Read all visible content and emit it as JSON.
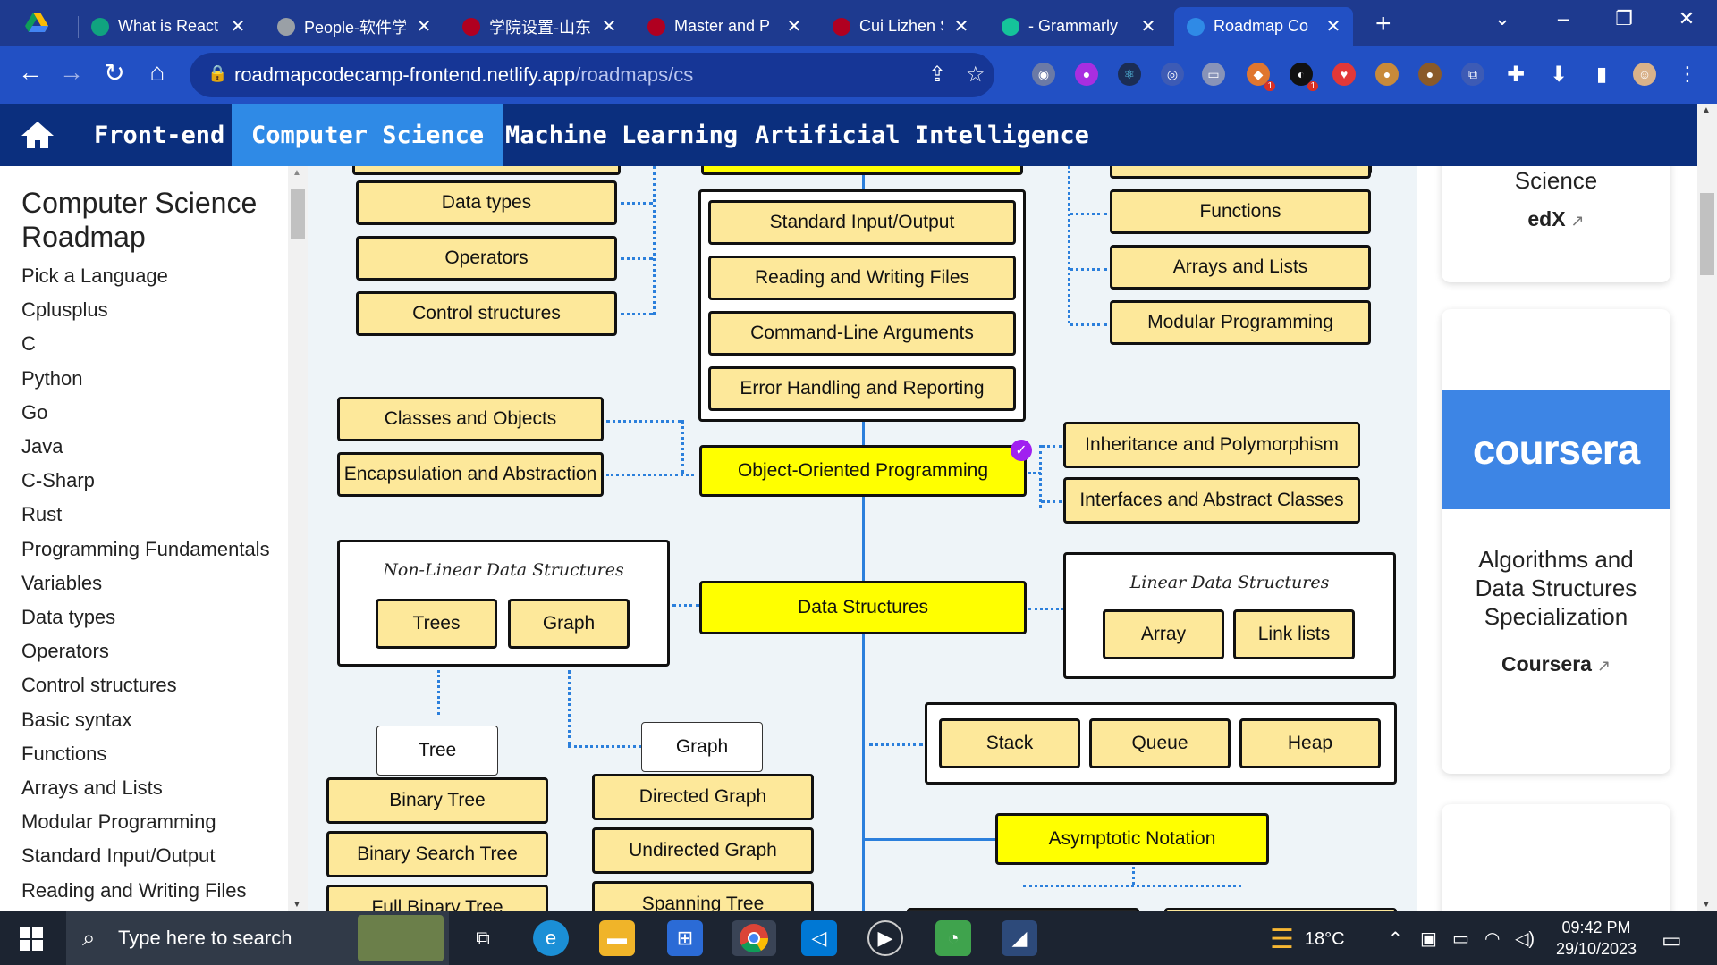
{
  "browser": {
    "tabs": [
      {
        "title": "What is React",
        "color": "#10a37f",
        "glyph": "chatgpt-icon"
      },
      {
        "title": "People-软件学",
        "color": "#9aa0a6",
        "glyph": "globe-icon"
      },
      {
        "title": "学院设置-山东",
        "color": "#b00020",
        "glyph": "university-icon"
      },
      {
        "title": "Master and P",
        "color": "#b00020",
        "glyph": "university-icon"
      },
      {
        "title": "Cui Lizhen Sh",
        "color": "#b00020",
        "glyph": "university-icon"
      },
      {
        "title": "- Grammarly",
        "color": "#15c39a",
        "glyph": "G"
      },
      {
        "title": "Roadmap Co",
        "color": "#2f8ae6",
        "glyph": "RC"
      }
    ],
    "url_host": "roadmapcodecamp-frontend.netlify.app",
    "url_path": "/roadmaps/cs",
    "ext_badges": [
      "1",
      "1"
    ]
  },
  "nav": {
    "items": [
      "Front-end",
      "Computer Science",
      "Machine Learning",
      "Artificial Intelligence"
    ],
    "active": "Computer Science"
  },
  "sidebar": {
    "title": "Computer Science Roadmap",
    "items": [
      "Pick a Language",
      "Cplusplus",
      "C",
      "Python",
      "Go",
      "Java",
      "C-Sharp",
      "Rust",
      "Programming Fundamentals",
      "Variables",
      "Data types",
      "Operators",
      "Control structures",
      "Basic syntax",
      "Functions",
      "Arrays and Lists",
      "Modular Programming",
      "Standard Input/Output",
      "Reading and Writing Files"
    ]
  },
  "roadmap": {
    "left_basics": [
      "Data types",
      "Operators",
      "Control structures"
    ],
    "io_group": [
      "Standard Input/Output",
      "Reading and Writing Files",
      "Command-Line Arguments",
      "Error Handling and Reporting"
    ],
    "right_basics": [
      "Functions",
      "Arrays and Lists",
      "Modular Programming"
    ],
    "oop": {
      "main": "Object-Oriented Programming",
      "left": [
        "Classes and Objects",
        "Encapsulation and Abstraction"
      ],
      "right": [
        "Inheritance and Polymorphism",
        "Interfaces and Abstract Classes"
      ]
    },
    "data_structures": {
      "main": "Data Structures",
      "nonlinear_title": "Non-Linear Data Structures",
      "nonlinear": [
        "Trees",
        "Graph"
      ],
      "linear_title": "Linear Data Structures",
      "linear": [
        "Array",
        "Link lists"
      ],
      "adt": [
        "Stack",
        "Queue",
        "Heap"
      ]
    },
    "tree_header": "Tree",
    "tree_items": [
      "Binary Tree",
      "Binary Search Tree",
      "Full Binary Tree"
    ],
    "graph_header": "Graph",
    "graph_items": [
      "Directed Graph",
      "Undirected Graph",
      "Spanning Tree"
    ],
    "asymptotic": "Asymptotic Notation"
  },
  "rail": {
    "card1_title": "Science",
    "card1_provider": "edX",
    "card2_banner": "coursera",
    "card2_title": "Algorithms and Data Structures Specialization",
    "card2_provider": "Coursera"
  },
  "taskbar": {
    "search_placeholder": "Type here to search",
    "temperature": "18°C",
    "time": "09:42 PM",
    "date": "29/10/2023"
  }
}
